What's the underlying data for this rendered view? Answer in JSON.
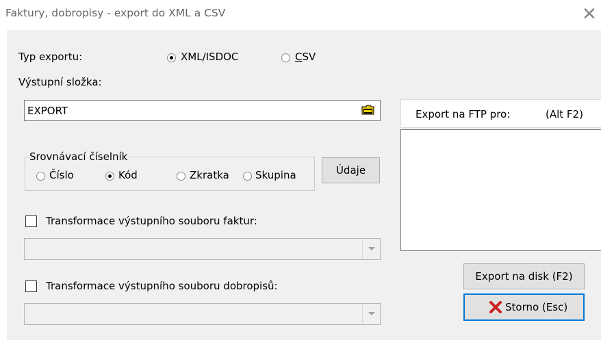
{
  "window": {
    "title": "Faktury, dobropisy - export do XML a CSV",
    "close_glyph": "✕"
  },
  "export_type": {
    "label": "Typ exportu:",
    "options": [
      {
        "label": "XML/ISDOC",
        "selected": true
      },
      {
        "label_underlined": "C",
        "label_rest": "SV",
        "selected": false
      }
    ]
  },
  "output_folder": {
    "label": "Výstupní složka:",
    "value": "EXPORT",
    "browse_icon": "folder-icon"
  },
  "codebook": {
    "legend": "Srovnávací číselník",
    "options": [
      {
        "label": "Číslo",
        "selected": false
      },
      {
        "label": "Kód",
        "selected": true
      },
      {
        "label": "Zkratka",
        "selected": false
      },
      {
        "label": "Skupina",
        "selected": false
      }
    ],
    "data_button": "Údaje"
  },
  "invoice_transform": {
    "label": "Transformace výstupního souboru faktur:",
    "checked": false,
    "value": ""
  },
  "credit_transform": {
    "label": "Transformace výstupního souboru dobropisů:",
    "checked": false,
    "value": ""
  },
  "ftp": {
    "label": "Export na FTP pro:",
    "shortcut": "(Alt F2)"
  },
  "buttons": {
    "export_disk": "Export na disk (F2)",
    "cancel": "Storno (Esc)",
    "cancel_icon": "red-x-icon",
    "cancel_icon_color": "#cc2222"
  },
  "colors": {
    "dialog_bg": "#f0f0f0",
    "button_bg": "#e1e1e1",
    "folder_icon": "#d4b000"
  }
}
